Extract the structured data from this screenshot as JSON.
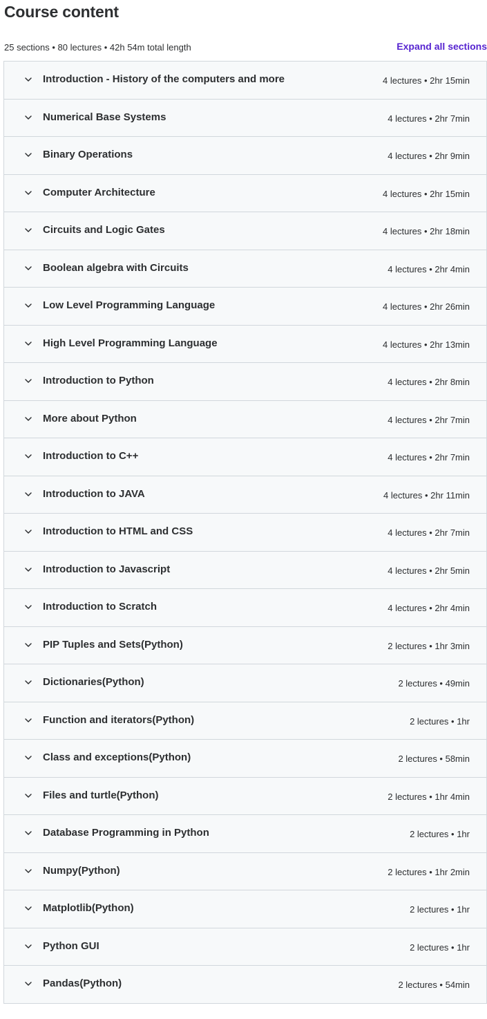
{
  "header": {
    "title": "Course content",
    "summary": "25 sections • 80 lectures • 42h 54m total length",
    "expand_all_label": "Expand all sections"
  },
  "accent_color": "#5624d0",
  "icons": {
    "section_toggle": "chevron-down-icon"
  },
  "sections": [
    {
      "title": "Introduction - History of the computers and more",
      "meta": "4 lectures • 2hr 15min"
    },
    {
      "title": "Numerical Base Systems",
      "meta": "4 lectures • 2hr 7min"
    },
    {
      "title": "Binary Operations",
      "meta": "4 lectures • 2hr 9min"
    },
    {
      "title": "Computer Architecture",
      "meta": "4 lectures • 2hr 15min"
    },
    {
      "title": "Circuits and Logic Gates",
      "meta": "4 lectures • 2hr 18min"
    },
    {
      "title": "Boolean algebra with Circuits",
      "meta": "4 lectures • 2hr 4min"
    },
    {
      "title": "Low Level Programming Language",
      "meta": "4 lectures • 2hr 26min"
    },
    {
      "title": "High Level Programming Language",
      "meta": "4 lectures • 2hr 13min"
    },
    {
      "title": "Introduction to Python",
      "meta": "4 lectures • 2hr 8min"
    },
    {
      "title": "More about Python",
      "meta": "4 lectures • 2hr 7min"
    },
    {
      "title": "Introduction to C++",
      "meta": "4 lectures • 2hr 7min"
    },
    {
      "title": "Introduction to JAVA",
      "meta": "4 lectures • 2hr 11min"
    },
    {
      "title": "Introduction to HTML and CSS",
      "meta": "4 lectures • 2hr 7min"
    },
    {
      "title": "Introduction to Javascript",
      "meta": "4 lectures • 2hr 5min"
    },
    {
      "title": "Introduction to Scratch",
      "meta": "4 lectures • 2hr 4min"
    },
    {
      "title": "PIP Tuples and Sets(Python)",
      "meta": "2 lectures • 1hr 3min"
    },
    {
      "title": "Dictionaries(Python)",
      "meta": "2 lectures • 49min"
    },
    {
      "title": "Function and iterators(Python)",
      "meta": "2 lectures • 1hr"
    },
    {
      "title": "Class and exceptions(Python)",
      "meta": "2 lectures • 58min"
    },
    {
      "title": "Files and turtle(Python)",
      "meta": "2 lectures • 1hr 4min"
    },
    {
      "title": "Database Programming in Python",
      "meta": "2 lectures • 1hr"
    },
    {
      "title": "Numpy(Python)",
      "meta": "2 lectures • 1hr 2min"
    },
    {
      "title": "Matplotlib(Python)",
      "meta": "2 lectures • 1hr"
    },
    {
      "title": "Python GUI",
      "meta": "2 lectures • 1hr"
    },
    {
      "title": "Pandas(Python)",
      "meta": "2 lectures • 54min"
    }
  ]
}
